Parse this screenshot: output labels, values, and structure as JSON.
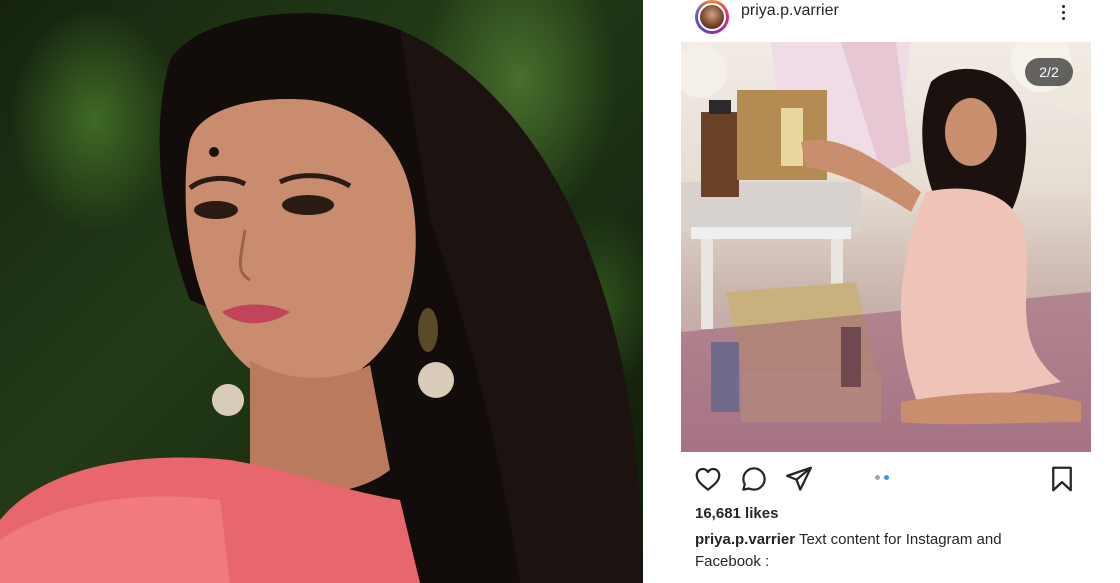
{
  "post": {
    "username": "priya.p.varrier",
    "carousel_counter": "2/2",
    "carousel_dots": [
      {
        "active": false
      },
      {
        "active": true
      }
    ],
    "likes": "16,681 likes",
    "caption_username": "priya.p.varrier",
    "caption_text": "Text content for Instagram and Facebook :"
  },
  "icons": {
    "more": "more-vertical-icon",
    "like": "heart-icon",
    "comment": "comment-icon",
    "share": "send-icon",
    "save": "bookmark-icon"
  },
  "colors": {
    "text": "#262626",
    "active_dot": "#3897f0",
    "inactive_dot": "#a8a8a8"
  }
}
